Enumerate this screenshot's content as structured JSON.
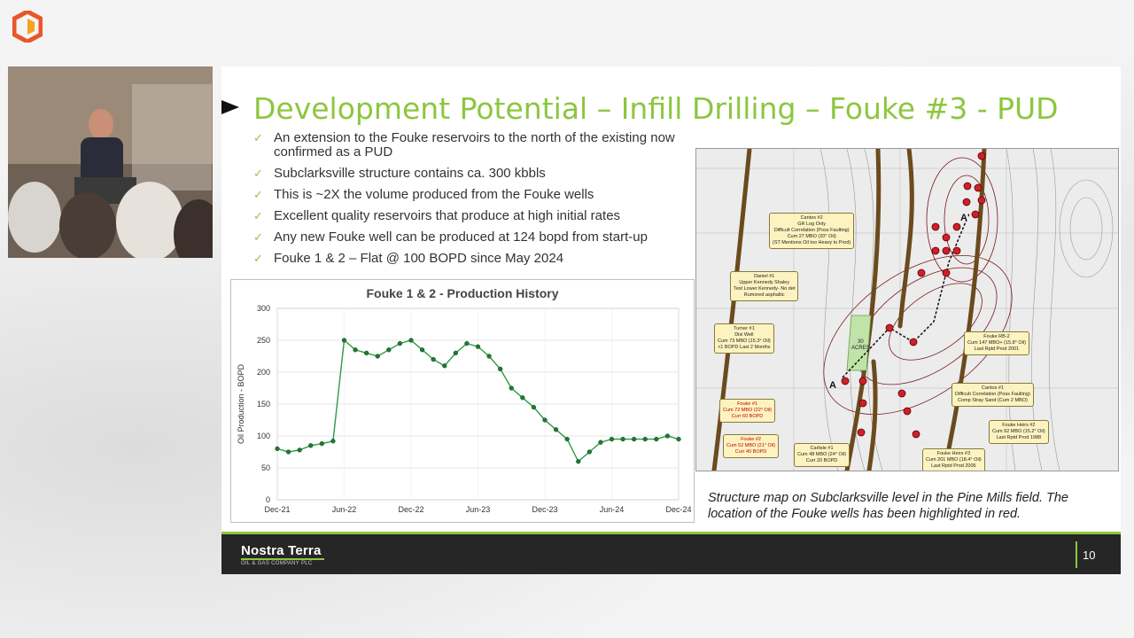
{
  "slide": {
    "title": "Development  Potential – Infill Drilling – Fouke #3 - PUD",
    "bullets": [
      "An extension to the Fouke reservoirs to the north of the existing now confirmed as a PUD",
      "Subclarksville structure contains ca. 300 kbbls",
      "This is ~2X the volume produced from the Fouke wells",
      "Excellent quality reservoirs that produce at high initial rates",
      "Any new Fouke well can be produced at 124 bopd from start-up",
      "Fouke 1 & 2 – Flat @ 100 BOPD since May 2024"
    ],
    "caption": "Structure map on Subclarksville level in the Pine Mills field. The location of the Fouke wells has been highlighted in red.",
    "page_number": "10"
  },
  "brand": {
    "name": "Nostra Terra",
    "subtitle": "OIL & GAS COMPANY PLC"
  },
  "colors": {
    "accent": "#8dc63f",
    "series": "#2e9b46",
    "footer": "#262626"
  },
  "map": {
    "letters": [
      "A",
      "A'"
    ],
    "labels": [
      {
        "text": "Cantos #2\nGR Log Only\nDifficult Correlation (Poss Faulting)\nCum 27 MBO (20° Oil)\n(ST Mentions Oil too Heavy to Prod)",
        "red": false
      },
      {
        "text": "Daniel #1\nUpper Kennedy Shaley\nTest Lower Kennedy- No det\nRumored asphaltic",
        "red": false
      },
      {
        "text": "Turner #1\nDixi Well\nCum 73 MBO (15.3° Oil)\n<1 BOPD Last 2 Months",
        "red": false
      },
      {
        "text": "Fouke RB-2\nCum 147 MBO+ (15.8° Oil)\nLast Rptd Prod 2001",
        "red": false
      },
      {
        "text": "Cantos #1\nDifficult Correlation (Poss Faulting)\nComp Stray Sand (Cum 2 MBO)",
        "red": false
      },
      {
        "text": "Fouke #1\nCum 72 MBO (22° Oil)\nCurr 60 BOPD",
        "red": true
      },
      {
        "text": "Fouke Heirs #2\nCum 92 MBO (15.2° Oil)\nLast Rptd Prod 1988",
        "red": false
      },
      {
        "text": "Fouke #2\nCum 52 MBO (21° Oil)\nCurr 40 BOPD",
        "red": true
      },
      {
        "text": "Carlisle #1\nCum 48 MBO (24° Oil)\nCurr 20 BOPD",
        "red": false
      },
      {
        "text": "Fouke Heirs #3\nCum 201 MBO (18.4° Oil)\nLast Rptd Prod 2006",
        "red": false
      }
    ],
    "acres_label": "30\nACRES"
  },
  "chart_data": {
    "type": "line",
    "title": "Fouke 1 & 2 - Production History",
    "xlabel": "",
    "ylabel": "Oil Production - BOPD",
    "ylim": [
      0,
      300
    ],
    "yticks": [
      0,
      50,
      100,
      150,
      200,
      250,
      300
    ],
    "xticks": [
      "Dec-21",
      "Jun-22",
      "Dec-22",
      "Jun-23",
      "Dec-23",
      "Jun-24",
      "Dec-24"
    ],
    "grid": true,
    "series": [
      {
        "x": [
          "Dec-21",
          "Jan-22",
          "Feb-22",
          "Mar-22",
          "Apr-22",
          "May-22",
          "Jun-22",
          "Jul-22",
          "Aug-22",
          "Sep-22",
          "Oct-22",
          "Nov-22",
          "Dec-22",
          "Jan-23",
          "Feb-23",
          "Mar-23",
          "Apr-23",
          "May-23",
          "Jun-23",
          "Jul-23",
          "Aug-23",
          "Sep-23",
          "Oct-23",
          "Nov-23",
          "Dec-23",
          "Jan-24",
          "Feb-24",
          "Mar-24",
          "Apr-24",
          "May-24",
          "Jun-24",
          "Jul-24",
          "Aug-24",
          "Sep-24",
          "Oct-24",
          "Nov-24",
          "Dec-24"
        ],
        "values": [
          80,
          75,
          78,
          85,
          88,
          92,
          250,
          235,
          230,
          225,
          235,
          245,
          250,
          235,
          220,
          210,
          230,
          245,
          240,
          225,
          205,
          175,
          160,
          145,
          125,
          110,
          95,
          60,
          75,
          90,
          95,
          95,
          95,
          95,
          95,
          100,
          95
        ]
      }
    ]
  }
}
